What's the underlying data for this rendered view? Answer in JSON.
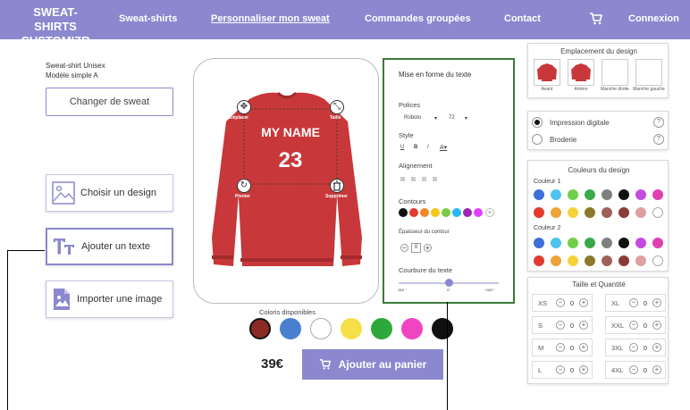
{
  "nav": {
    "logo": "SWEAT-SHIRTS CUSTOMIZR",
    "items": [
      "Sweat-shirts",
      "Personnaliser mon sweat",
      "Commandes groupées",
      "Contact",
      "Connexion"
    ]
  },
  "product": {
    "name": "Sweat-shirt Unisex",
    "model": "Modèle simple A",
    "change_label": "Changer de sweat"
  },
  "tools": {
    "design": "Choisir un design",
    "text": "Ajouter un texte",
    "import": "Importer une image"
  },
  "canvas": {
    "move": "Déplacer",
    "size": "Taille",
    "rotate": "Pivoter",
    "delete": "Supprimer",
    "line1": "MY NAME",
    "line2": "23"
  },
  "format": {
    "title": "Mise en forme du texte",
    "fonts_label": "Polices",
    "font_name": "Roboto",
    "font_size": "72",
    "style_label": "Style",
    "style_bold": "B",
    "style_italic": "I",
    "style_underline": "U",
    "align_label": "Alignement",
    "outline_label": "Contours",
    "thickness_label": "Épaisseur du contour",
    "thickness_value": "0",
    "curve_label": "Courbure du texte",
    "curve_min": "-359 °",
    "curve_mid": "0°",
    "curve_max": "+359 °",
    "curve_value_deg": 0,
    "outline_colors": [
      "#111111",
      "#e23a2e",
      "#f08a24",
      "#f5c518",
      "#7ac943",
      "#29b6f6",
      "#9c27b0",
      "#e040fb"
    ]
  },
  "placement": {
    "title": "Emplacement du design",
    "items": [
      "Avant",
      "Arrière",
      "Manche droite",
      "Manche gauche"
    ]
  },
  "print": {
    "digital": "Impression digitale",
    "embroidery": "Broderie",
    "help": "?"
  },
  "design_colors": {
    "title": "Couleurs du design",
    "color1_label": "Couleur 1",
    "color2_label": "Couleur 2",
    "palette_row1": [
      "#3f6fd8",
      "#4ec3f0",
      "#6fcf4a",
      "#3aa94a",
      "#808080",
      "#111111",
      "#c44be0",
      "#e040b0"
    ],
    "palette_row2": [
      "#e23a2e",
      "#f0a23a",
      "#f5d23a",
      "#8a7a2a",
      "#a0605a",
      "#8b3a3a",
      "#e0a0a0",
      "#ffffff"
    ]
  },
  "sizes": {
    "title": "Taille et Quantité",
    "left": [
      {
        "size": "XS",
        "qty": "0"
      },
      {
        "size": "S",
        "qty": "0"
      },
      {
        "size": "M",
        "qty": "0"
      },
      {
        "size": "L",
        "qty": "0"
      }
    ],
    "right": [
      {
        "size": "XL",
        "qty": "0"
      },
      {
        "size": "XXL",
        "qty": "0"
      },
      {
        "size": "3XL",
        "qty": "0"
      },
      {
        "size": "4XL",
        "qty": "0"
      }
    ],
    "minus": "−",
    "plus": "+"
  },
  "coloris": {
    "label": "Coloris disponibles",
    "colors": [
      "#8b2b25",
      "#4a7fd0",
      "#ffffff",
      "#f5e04a",
      "#2ea83a",
      "#ef45c0",
      "#111111"
    ]
  },
  "price": "39€",
  "cart_label": "Ajouter au panier",
  "colors": {
    "brand": "#8b88cf",
    "sweater": "#c8383a",
    "highlight": "#3a7a3a"
  }
}
